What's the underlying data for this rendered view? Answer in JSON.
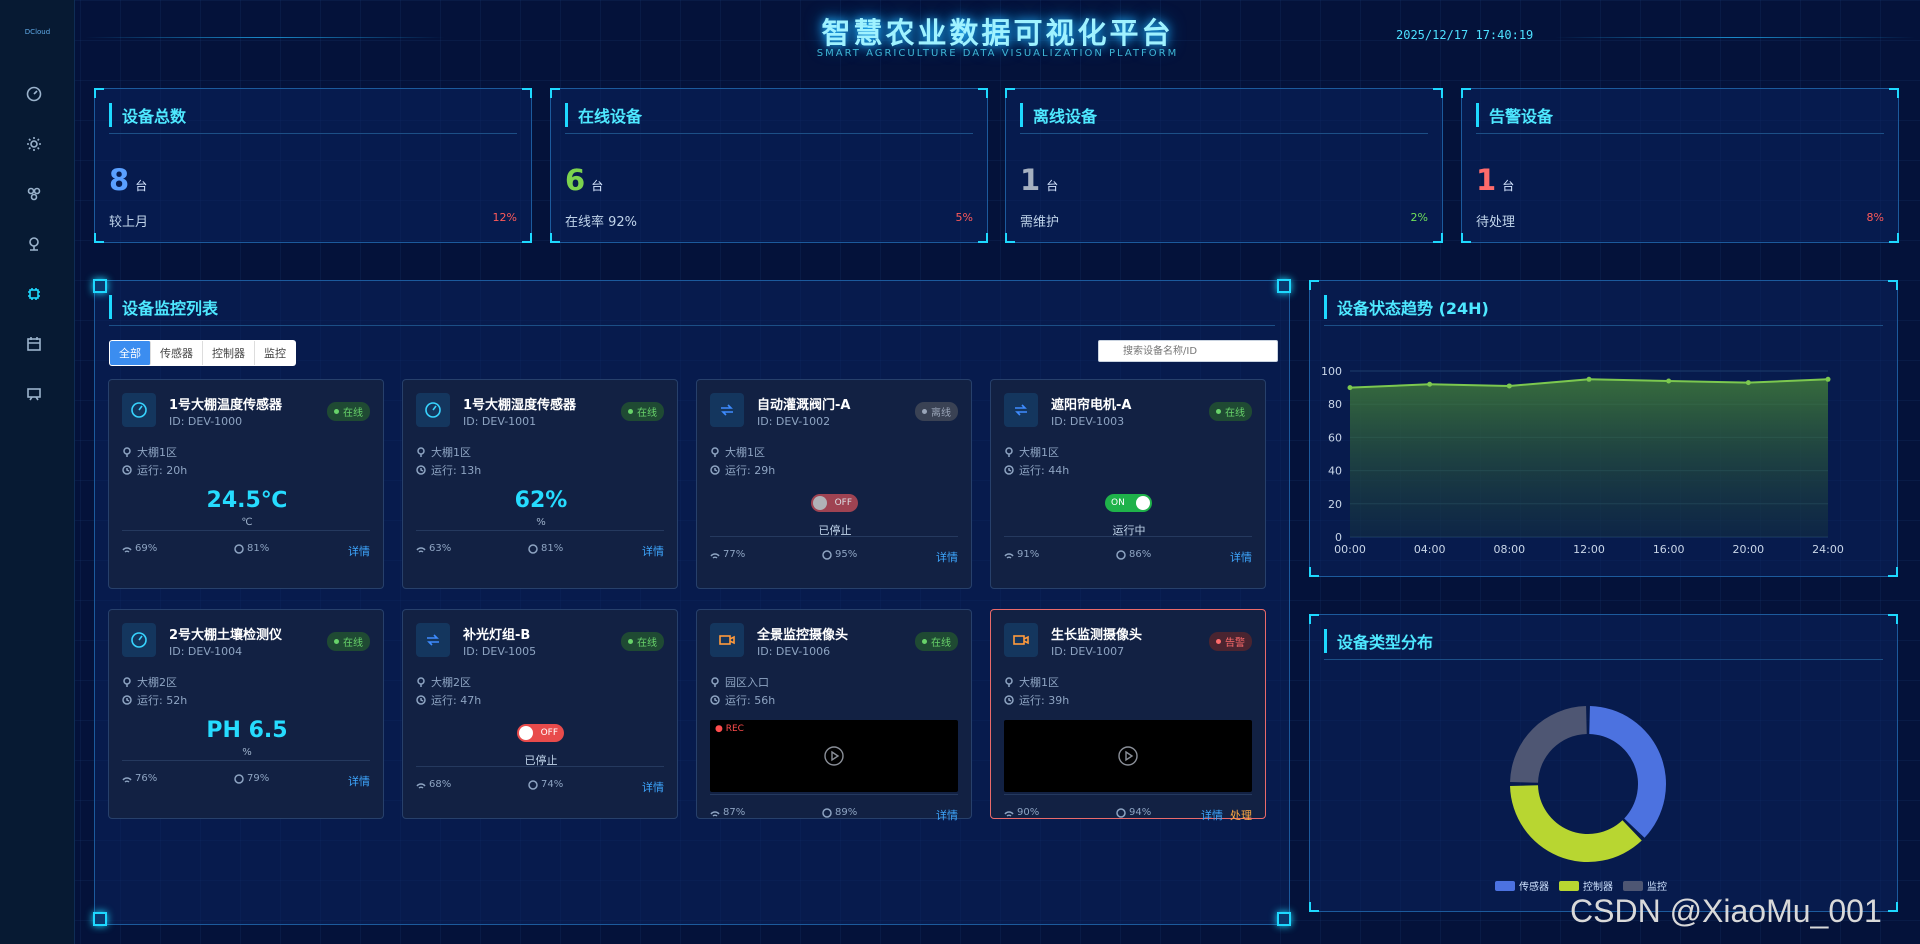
{
  "sidebar": {
    "logo": "DCloud",
    "icons": [
      "gauge-icon",
      "sun-icon",
      "network-icon",
      "location-icon",
      "chip-icon",
      "calendar-icon",
      "chat-icon"
    ],
    "active_index": 4
  },
  "header": {
    "title": "智慧农业数据可视化平台",
    "subtitle": "SMART AGRICULTURE DATA VISUALIZATION PLATFORM",
    "datetime": "2025/12/17 17:40:19"
  },
  "stats": [
    {
      "title": "设备总数",
      "value": "8",
      "unit": "台",
      "label": "较上月",
      "pct": "12%",
      "value_color": "#5aa0ff",
      "pct_color": "#ff5a5a"
    },
    {
      "title": "在线设备",
      "value": "6",
      "unit": "台",
      "label": "在线率 92%",
      "pct": "5%",
      "value_color": "#7cd34e",
      "pct_color": "#ff5a5a"
    },
    {
      "title": "离线设备",
      "value": "1",
      "unit": "台",
      "label": "需维护",
      "pct": "2%",
      "value_color": "#a5b0c0",
      "pct_color": "#6fe05a"
    },
    {
      "title": "告警设备",
      "value": "1",
      "unit": "台",
      "label": "待处理",
      "pct": "8%",
      "value_color": "#ff6b6b",
      "pct_color": "#ff5a5a"
    }
  ],
  "monitor": {
    "title": "设备监控列表",
    "tabs": [
      "全部",
      "传感器",
      "控制器",
      "监控"
    ],
    "active_tab": 0,
    "search_placeholder": "搜索设备名称/ID",
    "detail_label": "详情",
    "handle_label": "处理"
  },
  "devices": [
    {
      "name": "1号大棚温度传感器",
      "id": "ID: DEV-1000",
      "status": "在线",
      "status_type": "online",
      "kind": "sensor",
      "location": "大棚1区",
      "runtime": "运行: 20h",
      "value": "24.5℃",
      "unit": "℃",
      "signal": "69%",
      "battery": "81%"
    },
    {
      "name": "1号大棚湿度传感器",
      "id": "ID: DEV-1001",
      "status": "在线",
      "status_type": "online",
      "kind": "sensor",
      "location": "大棚1区",
      "runtime": "运行: 13h",
      "value": "62%",
      "unit": "%",
      "signal": "63%",
      "battery": "81%"
    },
    {
      "name": "自动灌溉阀门-A",
      "id": "ID: DEV-1002",
      "status": "离线",
      "status_type": "offline",
      "kind": "controller",
      "location": "大棚1区",
      "runtime": "运行: 29h",
      "toggle": "OFF",
      "toggle_state": "已停止",
      "signal": "77%",
      "battery": "95%"
    },
    {
      "name": "遮阳帘电机-A",
      "id": "ID: DEV-1003",
      "status": "在线",
      "status_type": "online",
      "kind": "controller",
      "location": "大棚1区",
      "runtime": "运行: 44h",
      "toggle": "ON",
      "toggle_state": "运行中",
      "signal": "91%",
      "battery": "86%"
    },
    {
      "name": "2号大棚土壤检测仪",
      "id": "ID: DEV-1004",
      "status": "在线",
      "status_type": "online",
      "kind": "sensor",
      "location": "大棚2区",
      "runtime": "运行: 52h",
      "value": "PH 6.5",
      "unit": "%",
      "signal": "76%",
      "battery": "79%"
    },
    {
      "name": "补光灯组-B",
      "id": "ID: DEV-1005",
      "status": "在线",
      "status_type": "online",
      "kind": "controller",
      "location": "大棚2区",
      "runtime": "运行: 47h",
      "toggle": "OFF",
      "toggle_state": "已停止",
      "signal": "68%",
      "battery": "74%"
    },
    {
      "name": "全景监控摄像头",
      "id": "ID: DEV-1006",
      "status": "在线",
      "status_type": "online",
      "kind": "camera",
      "location": "园区入口",
      "runtime": "运行: 56h",
      "rec": "REC",
      "signal": "87%",
      "battery": "89%"
    },
    {
      "name": "生长监测摄像头",
      "id": "ID: DEV-1007",
      "status": "告警",
      "status_type": "alarm",
      "kind": "camera",
      "location": "大棚1区",
      "runtime": "运行: 39h",
      "signal": "90%",
      "battery": "94%"
    }
  ],
  "trend": {
    "title": "设备状态趋势 (24H)"
  },
  "distribution": {
    "title": "设备类型分布"
  },
  "chart_data": [
    {
      "type": "area",
      "title": "设备状态趋势 (24H)",
      "x": [
        "00:00",
        "04:00",
        "08:00",
        "12:00",
        "16:00",
        "20:00",
        "24:00"
      ],
      "series": [
        {
          "values": [
            90,
            92,
            91,
            95,
            94,
            93,
            95
          ]
        }
      ],
      "ylim": [
        0,
        100
      ],
      "yticks": [
        0,
        20,
        40,
        60,
        80,
        100
      ],
      "grid": true,
      "color": "#7cc84f"
    },
    {
      "type": "pie",
      "title": "设备类型分布",
      "labels": [
        "传感器",
        "控制器",
        "监控"
      ],
      "values": [
        3,
        3,
        2
      ],
      "colors": [
        "#4c72e0",
        "#b8d631",
        "#4e5673"
      ],
      "legend": "bottom"
    }
  ],
  "watermark": "CSDN @XiaoMu_001"
}
